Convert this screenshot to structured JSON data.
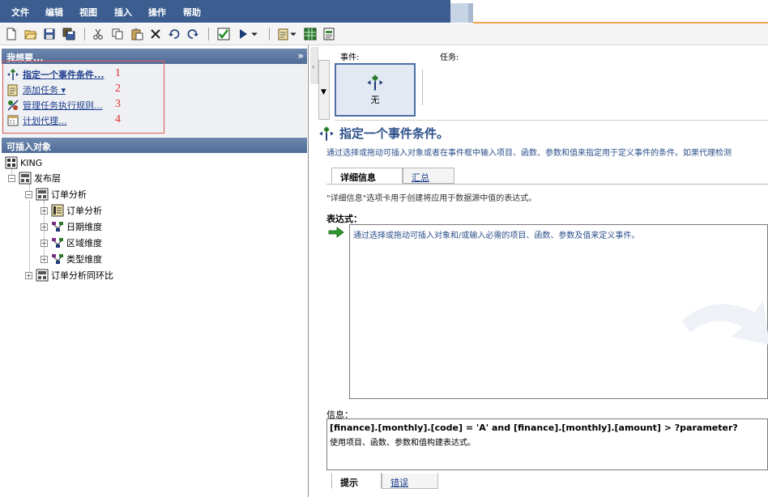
{
  "menubar": {
    "items": [
      "文件",
      "编辑",
      "视图",
      "插入",
      "操作",
      "帮助"
    ],
    "bg_color": "#3b5d8f"
  },
  "toolbar": {
    "buttons": [
      "new-icon",
      "open-icon",
      "save-icon",
      "save-all-icon",
      "cut-icon",
      "copy-icon",
      "paste-icon",
      "delete-icon",
      "undo-icon",
      "redo-icon",
      "validate-icon",
      "run-icon",
      "run-menu-icon",
      "properties-icon",
      "grid-icon",
      "report-icon"
    ]
  },
  "wish_panel": {
    "header": "我想要...",
    "items": [
      {
        "label": "指定一个事件条件...",
        "number": "1",
        "bold": true
      },
      {
        "label": "添加任务 ▾",
        "number": "2",
        "bold": false
      },
      {
        "label": "管理任务执行规则...",
        "number": "3",
        "bold": false
      },
      {
        "label": "计划代理...",
        "number": "4",
        "bold": false
      }
    ],
    "highlight_color": "#e05a5a"
  },
  "insertable_panel": {
    "header": "可插入对象",
    "tree": [
      {
        "label": "KING"
      },
      {
        "label": "发布层"
      },
      {
        "label": "订单分析"
      },
      {
        "label": "订单分析"
      },
      {
        "label": "日期维度"
      },
      {
        "label": "区域维度"
      },
      {
        "label": "类型维度"
      },
      {
        "label": "订单分析同环比"
      }
    ]
  },
  "right_panel": {
    "event_label": "事件:",
    "task_label": "任务:",
    "event_tile_label": "无",
    "section_title": "指定一个事件条件。",
    "description": "通过选择或拖动可插入对象或者在事件框中输入项目、函数、参数和值来指定用于定义事件的条件。如果代理检测",
    "tabs": [
      "详细信息",
      "汇总"
    ],
    "details_note": "\"详细信息\"选项卡用于创建将应用于数据源中值的表达式。",
    "expression_label": "表达式：",
    "expression_placeholder": "通过选择或拖动可插入对象和/或输入必需的项目、函数、参数及值来定义事件。",
    "info_label": "信息：",
    "info_expression": "[finance].[monthly].[code] = 'A' and [finance].[monthly].[amount] > ?parameter?",
    "info_help": "使用项目、函数、参数和值构建表达式。",
    "bottom_tabs": [
      "提示",
      "错误"
    ],
    "accent_color": "#2c4f8a"
  }
}
